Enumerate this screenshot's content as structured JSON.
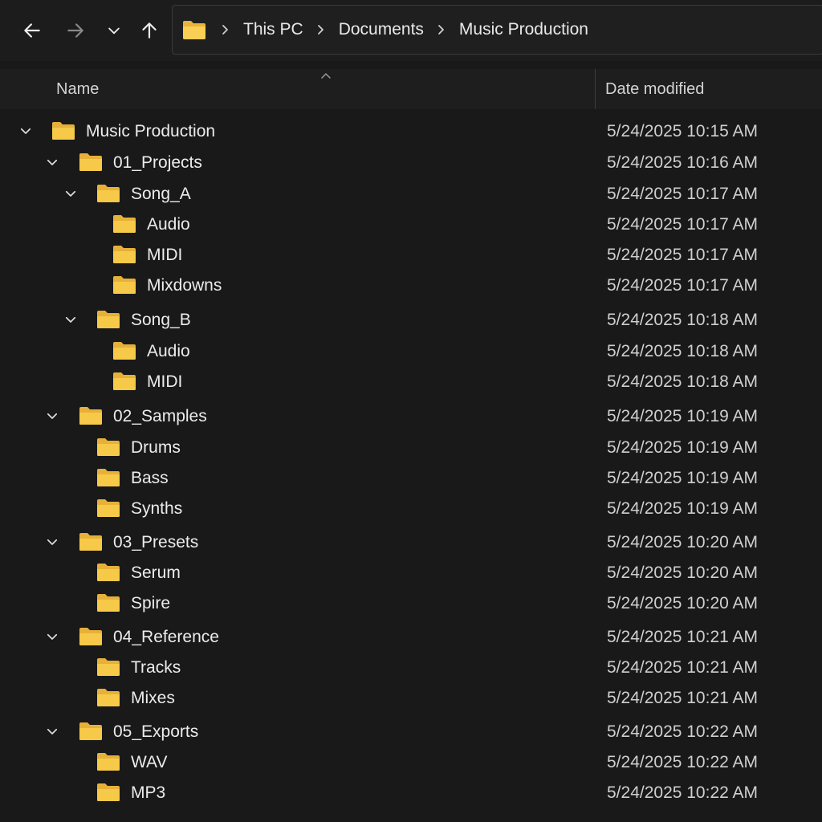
{
  "navigation": {
    "back_icon": "arrow-left-icon",
    "forward_icon": "arrow-right-icon",
    "recent_icon": "chevron-down-icon",
    "up_icon": "arrow-up-icon"
  },
  "address": {
    "icon": "folder-icon",
    "breadcrumbs": [
      "This PC",
      "Documents",
      "Music Production"
    ]
  },
  "columns": {
    "name": "Name",
    "date_modified": "Date modified"
  },
  "colors": {
    "background": "#191919",
    "folder": "#f7c948",
    "text": "#ececec"
  },
  "tree": [
    {
      "name": "Music Production",
      "date": "5/24/2025 10:15 AM",
      "depth": 0,
      "expanded": true
    },
    {
      "name": "01_Projects",
      "date": "5/24/2025 10:16 AM",
      "depth": 1,
      "expanded": true
    },
    {
      "name": "Song_A",
      "date": "5/24/2025 10:17 AM",
      "depth": 2,
      "expanded": true
    },
    {
      "name": "Audio",
      "date": "5/24/2025 10:17 AM",
      "depth": 3,
      "expanded": false
    },
    {
      "name": "MIDI",
      "date": "5/24/2025 10:17 AM",
      "depth": 3,
      "expanded": false
    },
    {
      "name": "Mixdowns",
      "date": "5/24/2025 10:17 AM",
      "depth": 3,
      "expanded": false
    },
    {
      "name": "Song_B",
      "date": "5/24/2025 10:18 AM",
      "depth": 2,
      "expanded": true
    },
    {
      "name": "Audio",
      "date": "5/24/2025 10:18 AM",
      "depth": 3,
      "expanded": false
    },
    {
      "name": "MIDI",
      "date": "5/24/2025 10:18 AM",
      "depth": 3,
      "expanded": false
    },
    {
      "name": "02_Samples",
      "date": "5/24/2025 10:19 AM",
      "depth": 1,
      "expanded": true
    },
    {
      "name": "Drums",
      "date": "5/24/2025 10:19 AM",
      "depth": 2,
      "expanded": false
    },
    {
      "name": "Bass",
      "date": "5/24/2025 10:19 AM",
      "depth": 2,
      "expanded": false
    },
    {
      "name": "Synths",
      "date": "5/24/2025 10:19 AM",
      "depth": 2,
      "expanded": false
    },
    {
      "name": "03_Presets",
      "date": "5/24/2025 10:20 AM",
      "depth": 1,
      "expanded": true
    },
    {
      "name": "Serum",
      "date": "5/24/2025 10:20 AM",
      "depth": 2,
      "expanded": false
    },
    {
      "name": "Spire",
      "date": "5/24/2025 10:20 AM",
      "depth": 2,
      "expanded": false
    },
    {
      "name": "04_Reference",
      "date": "5/24/2025 10:21 AM",
      "depth": 1,
      "expanded": true
    },
    {
      "name": "Tracks",
      "date": "5/24/2025 10:21 AM",
      "depth": 2,
      "expanded": false
    },
    {
      "name": "Mixes",
      "date": "5/24/2025 10:21 AM",
      "depth": 2,
      "expanded": false
    },
    {
      "name": "05_Exports",
      "date": "5/24/2025 10:22 AM",
      "depth": 1,
      "expanded": true
    },
    {
      "name": "WAV",
      "date": "5/24/2025 10:22 AM",
      "depth": 2,
      "expanded": false
    },
    {
      "name": "MP3",
      "date": "5/24/2025 10:22 AM",
      "depth": 2,
      "expanded": false
    }
  ]
}
